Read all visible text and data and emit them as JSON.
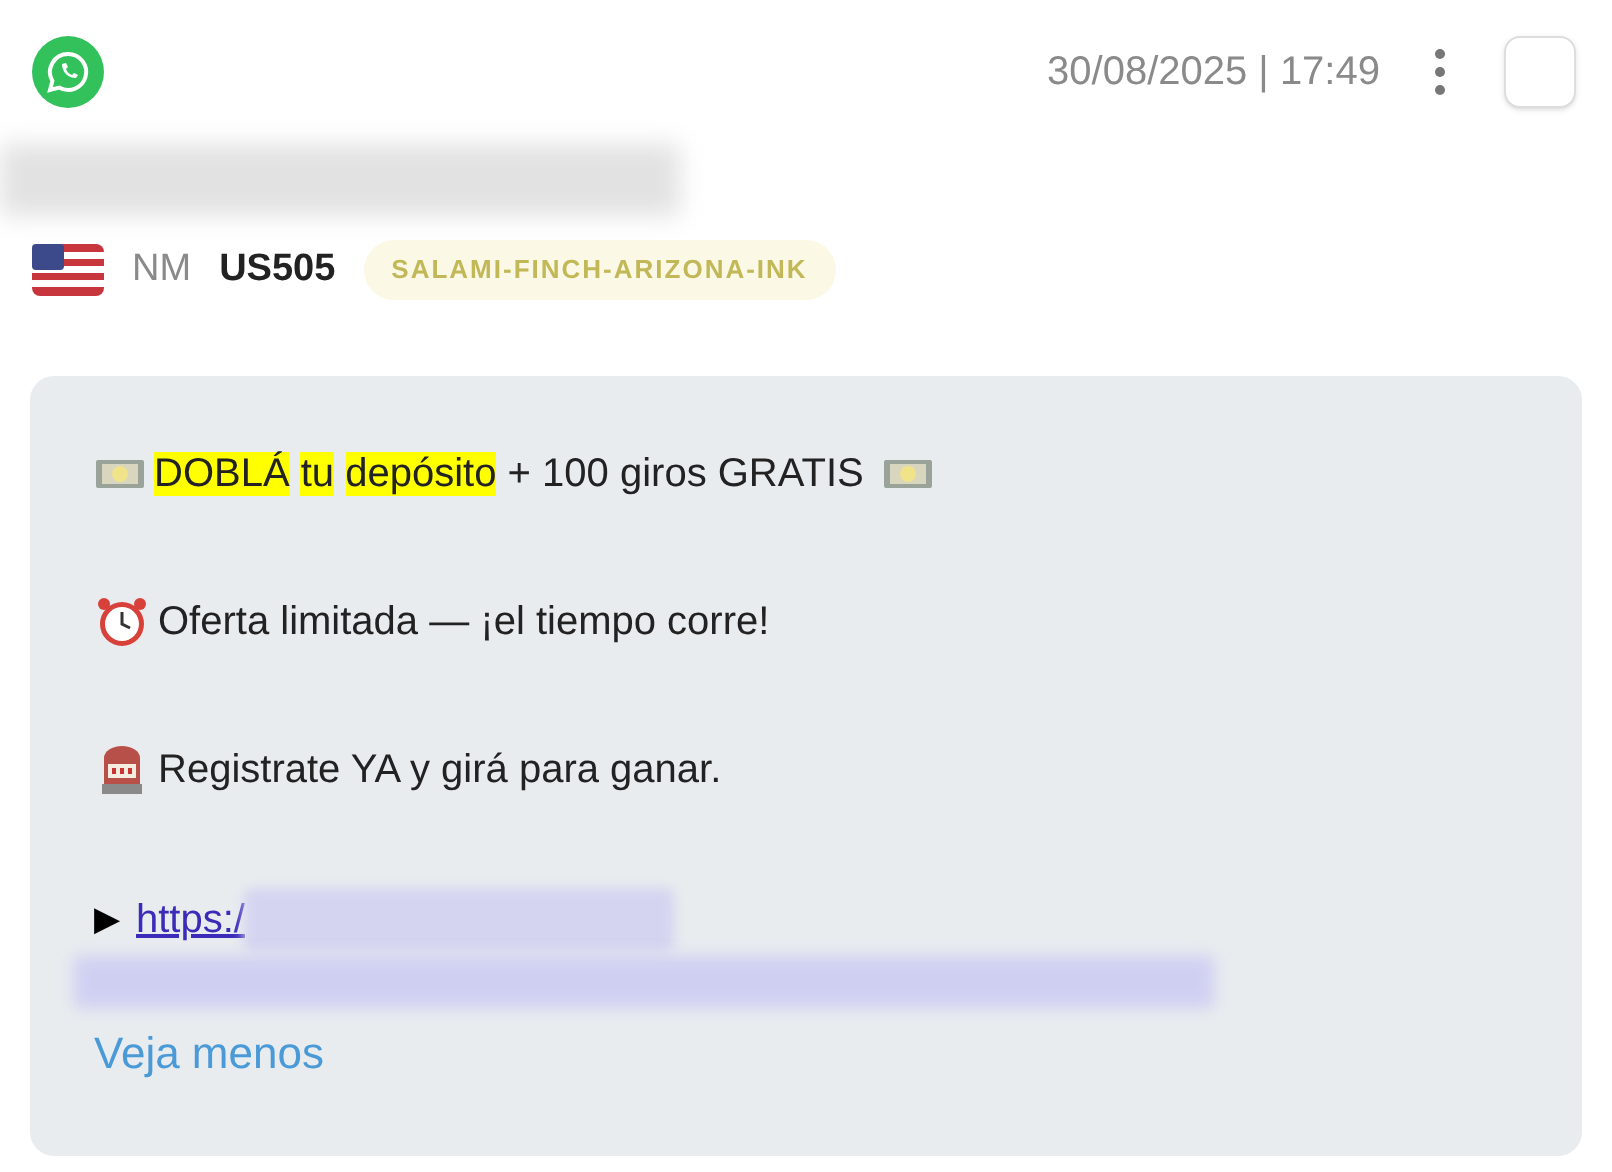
{
  "header": {
    "timestamp": "30/08/2025 | 17:49",
    "checkbox": {
      "checked": false
    }
  },
  "sender": {
    "initials": "NM",
    "code": "US505",
    "tag": "SALAMI-FINCH-ARIZONA-INK"
  },
  "message": {
    "lines": [
      {
        "kind": "promo",
        "segments": [
          {
            "text": "DOBLÁ",
            "highlighted": true
          },
          {
            "text": "tu",
            "highlighted": true
          },
          {
            "text": "depósito",
            "highlighted": true
          },
          {
            "text": " + 100 giros GRATIS ",
            "highlighted": false
          }
        ]
      },
      {
        "kind": "offer",
        "segments": [
          {
            "text": "Oferta limitada — ¡el tiempo corre!",
            "highlighted": false
          }
        ]
      },
      {
        "kind": "register",
        "segments": [
          {
            "text": "Registrate YA y girá para ganar.",
            "highlighted": false
          }
        ]
      },
      {
        "kind": "link",
        "marker": "▶",
        "url": "https:/"
      }
    ],
    "toggle": "Veja menos"
  }
}
